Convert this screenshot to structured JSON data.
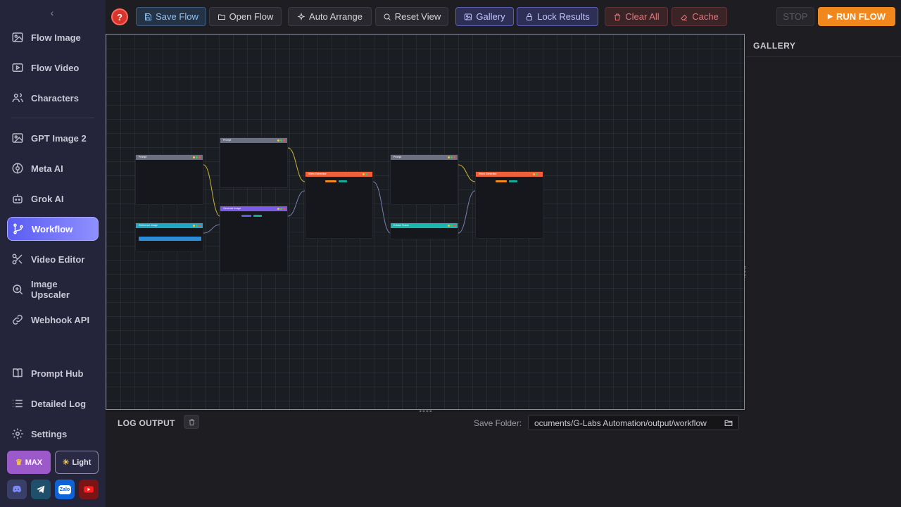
{
  "sidebar": {
    "collapse_icon": "chevron-left-icon",
    "items": [
      {
        "label": "Flow Image",
        "icon": "image-icon"
      },
      {
        "label": "Flow Video",
        "icon": "video-icon"
      },
      {
        "label": "Characters",
        "icon": "users-icon"
      },
      {
        "label": "GPT Image 2",
        "icon": "image-icon"
      },
      {
        "label": "Meta AI",
        "icon": "meta-icon"
      },
      {
        "label": "Grok AI",
        "icon": "bot-icon"
      },
      {
        "label": "Workflow",
        "icon": "workflow-icon",
        "active": true
      },
      {
        "label": "Video Editor",
        "icon": "scissors-icon"
      },
      {
        "label": "Image Upscaler",
        "icon": "zoom-in-icon"
      },
      {
        "label": "Webhook API",
        "icon": "link-icon"
      },
      {
        "label": "Prompt Hub",
        "icon": "book-icon"
      },
      {
        "label": "Detailed Log",
        "icon": "list-icon"
      },
      {
        "label": "Settings",
        "icon": "gear-icon"
      }
    ],
    "max_label": "MAX",
    "theme_label": "Light",
    "socials": [
      "discord-icon",
      "telegram-icon",
      "zalo-icon",
      "youtube-icon"
    ],
    "zalo_text": "Zalo"
  },
  "toolbar": {
    "help": "?",
    "save_flow": "Save Flow",
    "open_flow": "Open Flow",
    "auto_arrange": "Auto Arrange",
    "reset_view": "Reset View",
    "gallery": "Gallery",
    "lock_results": "Lock Results",
    "clear_all": "Clear All",
    "cache": "Cache",
    "stop": "STOP",
    "run_flow": "RUN FLOW"
  },
  "canvas": {
    "nodes": [
      {
        "title": "Prompt",
        "color": "#6a7080"
      },
      {
        "title": "Prompt",
        "color": "#6a7080"
      },
      {
        "title": "Reference Image",
        "color": "#1fa8c4"
      },
      {
        "title": "Generate Image",
        "color": "#7b5ce6"
      },
      {
        "title": "Video Generator",
        "color": "#f0613a"
      },
      {
        "title": "Prompt",
        "color": "#6a7080"
      },
      {
        "title": "Extract Frame",
        "color": "#19b7b0"
      },
      {
        "title": "Video Generator",
        "color": "#f0613a"
      }
    ]
  },
  "gallery": {
    "title": "GALLERY"
  },
  "log": {
    "title": "LOG OUTPUT",
    "save_folder_label": "Save Folder:",
    "save_folder_value": "ocuments/G-Labs Automation/output/workflow"
  }
}
